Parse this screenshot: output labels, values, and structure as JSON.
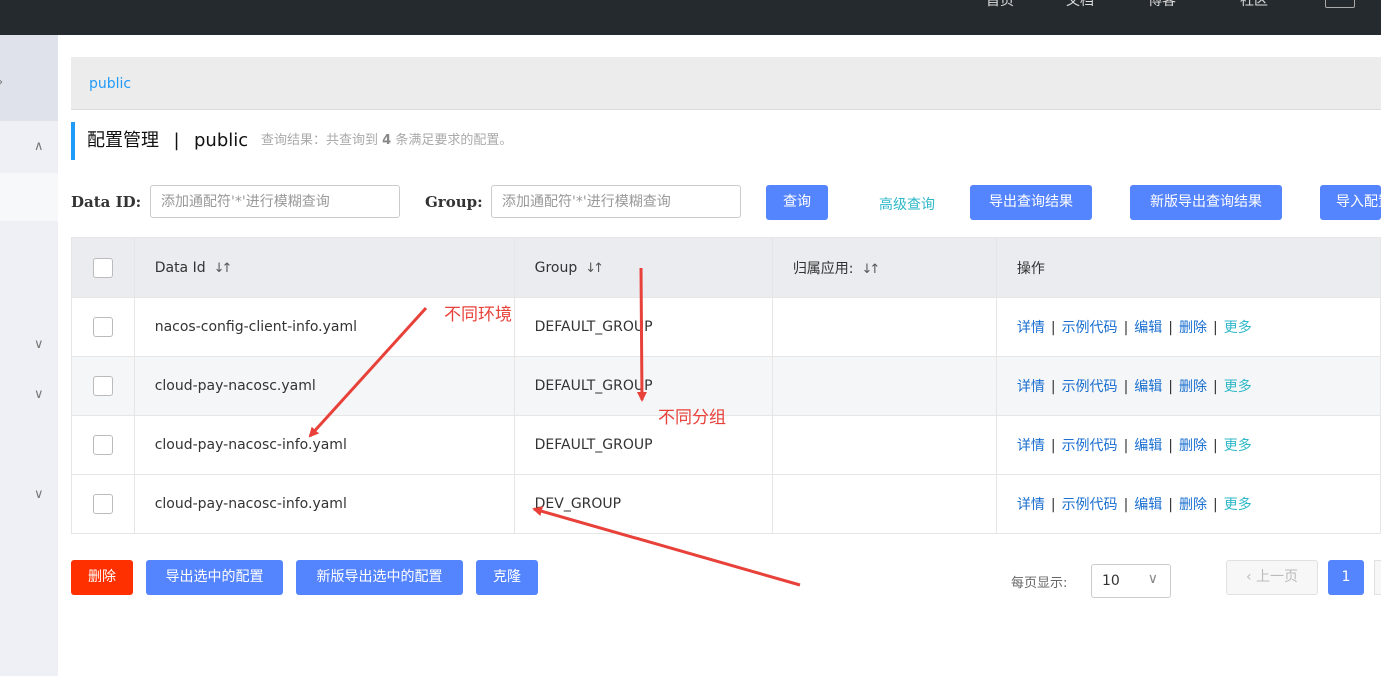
{
  "topbar": {
    "nav": [
      "首页",
      "文档",
      "博客",
      "社区"
    ]
  },
  "breadcrumb": "public",
  "title": {
    "main": "配置管理",
    "sep": "|",
    "namespace": "public",
    "result_prefix": "查询结果：共查询到",
    "result_count": "4",
    "result_suffix": "条满足要求的配置。"
  },
  "search": {
    "dataid_label": "Data ID:",
    "dataid_placeholder": "添加通配符'*'进行模糊查询",
    "group_label": "Group:",
    "group_placeholder": "添加通配符'*'进行模糊查询",
    "query_btn": "查询",
    "advanced_link": "高级查询",
    "export_btn": "导出查询结果",
    "export_new_btn": "新版导出查询结果",
    "import_btn": "导入配置"
  },
  "table": {
    "headers": {
      "dataid": "Data Id",
      "group": "Group",
      "app": "归属应用:",
      "ops": "操作"
    },
    "rows": [
      {
        "dataid": "nacos-config-client-info.yaml",
        "group": "DEFAULT_GROUP",
        "app": ""
      },
      {
        "dataid": "cloud-pay-nacosc.yaml",
        "group": "DEFAULT_GROUP",
        "app": ""
      },
      {
        "dataid": "cloud-pay-nacosc-info.yaml",
        "group": "DEFAULT_GROUP",
        "app": ""
      },
      {
        "dataid": "cloud-pay-nacosc-info.yaml",
        "group": "DEV_GROUP",
        "app": ""
      }
    ],
    "ops": {
      "detail": "详情",
      "sample": "示例代码",
      "edit": "编辑",
      "delete": "删除",
      "more": "更多",
      "sep": "|"
    }
  },
  "bottom": {
    "delete": "删除",
    "export_selected": "导出选中的配置",
    "export_selected_new": "新版导出选中的配置",
    "clone": "克隆"
  },
  "pagination": {
    "page_size_label": "每页显示:",
    "page_size": "10",
    "prev": "上一页",
    "current": "1"
  },
  "annotations": {
    "env": "不同环境",
    "group": "不同分组"
  },
  "colors": {
    "primary": "#5584ff",
    "danger": "#ff3000",
    "link": "#1a6fd0",
    "annotation": "#e8413a",
    "accent": "#209bfa"
  }
}
